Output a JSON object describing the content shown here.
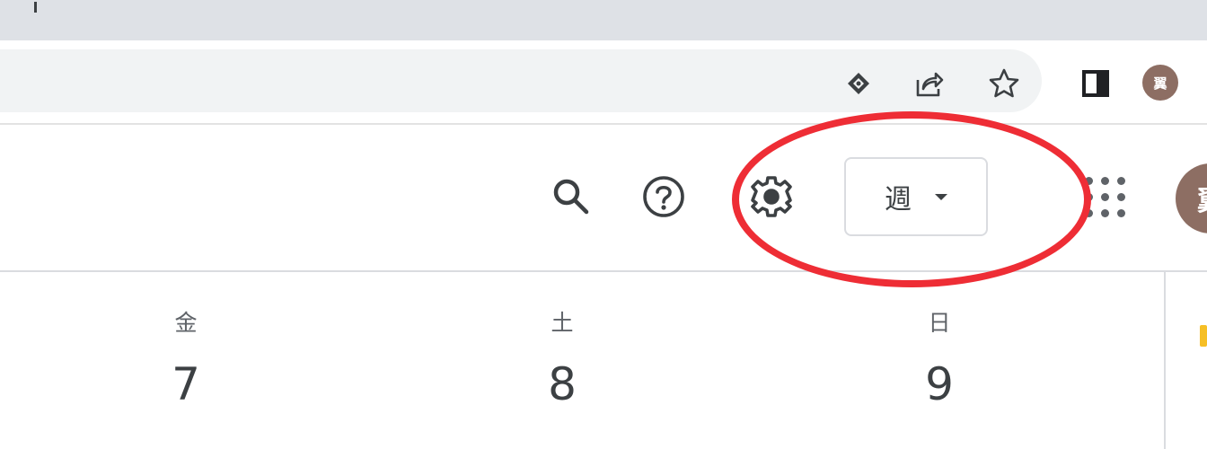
{
  "browser": {
    "icons": [
      "password-key-icon",
      "share-icon",
      "star-icon",
      "side-panel-icon"
    ],
    "profile_initial": "翼"
  },
  "calendar_header": {
    "icons": [
      "search-icon",
      "help-icon",
      "gear-icon",
      "apps-grid-icon"
    ],
    "view_selector": {
      "label": "週"
    },
    "account_initial": "翼"
  },
  "days": [
    {
      "dow": "金",
      "date": "7"
    },
    {
      "dow": "土",
      "date": "8"
    },
    {
      "dow": "日",
      "date": "9"
    }
  ],
  "colors": {
    "annotation": "#ee2d35",
    "avatar": "#8d6e63",
    "icon": "#3c4043"
  }
}
